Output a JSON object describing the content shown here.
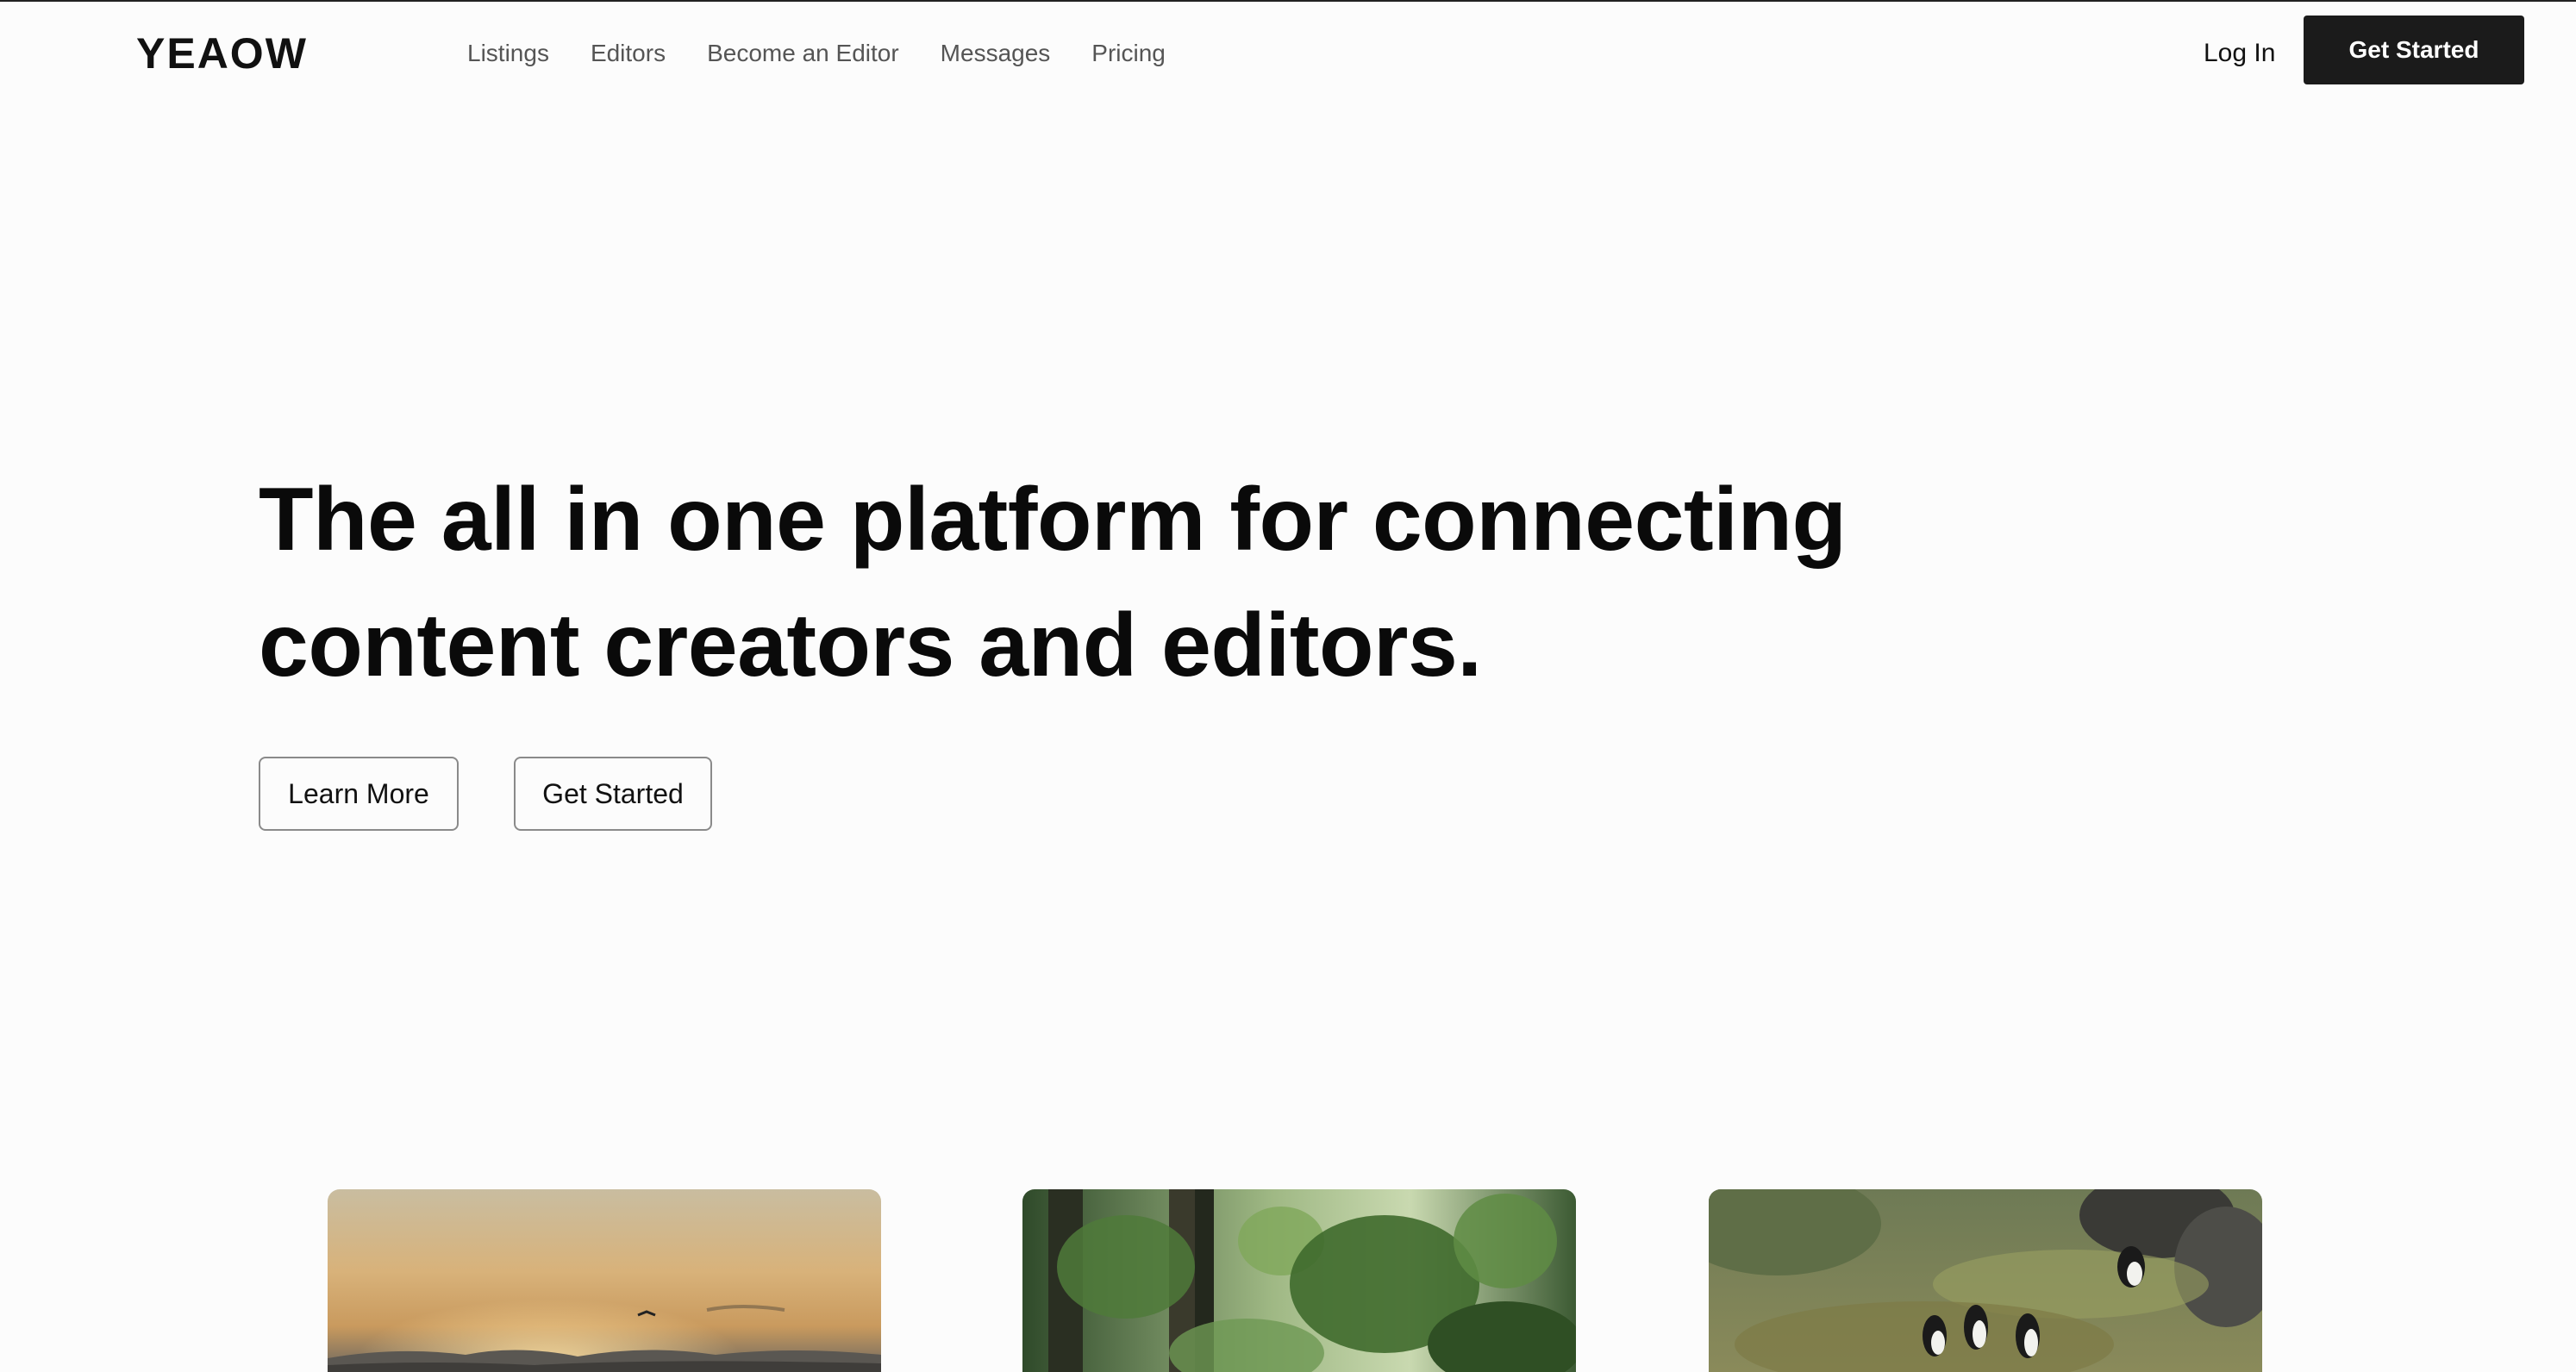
{
  "header": {
    "logo": "YEAOW",
    "nav": [
      {
        "label": "Listings"
      },
      {
        "label": "Editors"
      },
      {
        "label": "Become an Editor"
      },
      {
        "label": "Messages"
      },
      {
        "label": "Pricing"
      }
    ],
    "login_label": "Log In",
    "cta_label": "Get Started"
  },
  "hero": {
    "title_line1": "The all in one platform for connecting",
    "title_line2": "content creators and editors.",
    "learn_more_label": "Learn More",
    "get_started_label": "Get Started"
  },
  "cards": [
    {
      "subject": "sunset-sky"
    },
    {
      "subject": "jungle-foliage"
    },
    {
      "subject": "puffins-on-grass"
    }
  ],
  "colors": {
    "background": "#fcfcfc",
    "primary_button": "#1b1b1b",
    "nav_text": "#555555"
  }
}
